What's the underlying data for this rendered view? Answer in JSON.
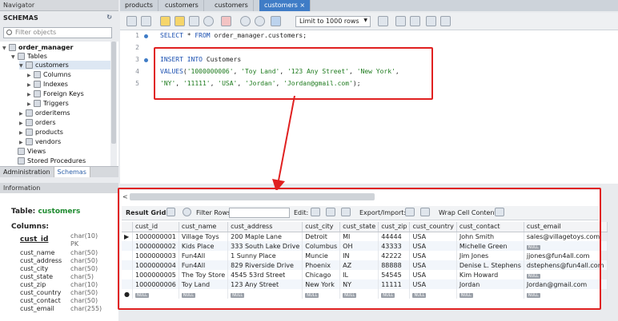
{
  "navigator": {
    "title": "Navigator",
    "schemas_label": "SCHEMAS",
    "filter_placeholder": "Filter objects",
    "tree": {
      "db": "order_manager",
      "tables": "Tables",
      "customers": "customers",
      "columns": "Columns",
      "indexes": "Indexes",
      "fkeys": "Foreign Keys",
      "triggers": "Triggers",
      "orderitems": "orderitems",
      "orders": "orders",
      "products": "products",
      "vendors": "vendors",
      "views": "Views",
      "procs": "Stored Procedures"
    },
    "tabs": [
      "Administration",
      "Schemas"
    ],
    "info_label": "Information",
    "info": {
      "table_label": "Table:",
      "table_name": "customers",
      "columns_label": "Columns:",
      "columns": [
        {
          "name": "cust_id",
          "type": "char(10)",
          "extra": "PK"
        },
        {
          "name": "cust_name",
          "type": "char(50)"
        },
        {
          "name": "cust_address",
          "type": "char(50)"
        },
        {
          "name": "cust_city",
          "type": "char(50)"
        },
        {
          "name": "cust_state",
          "type": "char(5)"
        },
        {
          "name": "cust_zip",
          "type": "char(10)"
        },
        {
          "name": "cust_country",
          "type": "char(50)"
        },
        {
          "name": "cust_contact",
          "type": "char(50)"
        },
        {
          "name": "cust_email",
          "type": "char(255)"
        }
      ]
    }
  },
  "tabs": [
    "products",
    "customers",
    "customers",
    "customers"
  ],
  "active_tab_close": "×",
  "toolbar": {
    "limit": "Limit to 1000 rows"
  },
  "editor": {
    "lines": [
      "1",
      "2",
      "3",
      "4",
      "5"
    ],
    "l1_kw1": "SELECT",
    "l1_mid": " * ",
    "l1_kw2": "FROM",
    "l1_rest": " order_manager.customers;",
    "l3_kw1": "INSERT",
    "l3_kw2": "INTO",
    "l3_rest": " Customers",
    "l4_kw": "VALUES",
    "l4_p1": "(",
    "l4_v1": "'1000000006'",
    "l4_c1": ", ",
    "l4_v2": "'Toy Land'",
    "l4_c2": ", ",
    "l4_v3": "'123 Any Street'",
    "l4_c3": ", ",
    "l4_v4": "'New York'",
    "l4_c4": ",",
    "l5_v1": "'NY'",
    "l5_c1": ", ",
    "l5_v2": "'11111'",
    "l5_c2": ", ",
    "l5_v3": "'USA'",
    "l5_c3": ", ",
    "l5_v4": "'Jordan'",
    "l5_c4": ", ",
    "l5_v5": "'Jordan@gmail.com'",
    "l5_end": ");"
  },
  "result": {
    "lt": "<",
    "grid_label": "Result Grid",
    "filter_label": "Filter Rows:",
    "edit_label": "Edit:",
    "export_label": "Export/Import:",
    "wrap_label": "Wrap Cell Content:",
    "columns": [
      "cust_id",
      "cust_name",
      "cust_address",
      "cust_city",
      "cust_state",
      "cust_zip",
      "cust_country",
      "cust_contact",
      "cust_email"
    ],
    "rows": [
      [
        "1000000001",
        "Village Toys",
        "200 Maple Lane",
        "Detroit",
        "MI",
        "44444",
        "USA",
        "John Smith",
        "sales@villagetoys.com"
      ],
      [
        "1000000002",
        "Kids Place",
        "333 South Lake Drive",
        "Columbus",
        "OH",
        "43333",
        "USA",
        "Michelle Green",
        "NULL"
      ],
      [
        "1000000003",
        "Fun4All",
        "1 Sunny Place",
        "Muncie",
        "IN",
        "42222",
        "USA",
        "Jim Jones",
        "jjones@fun4all.com"
      ],
      [
        "1000000004",
        "Fun4All",
        "829 Riverside Drive",
        "Phoenix",
        "AZ",
        "88888",
        "USA",
        "Denise L. Stephens",
        "dstephens@fun4all.com"
      ],
      [
        "1000000005",
        "The Toy Store",
        "4545 53rd Street",
        "Chicago",
        "IL",
        "54545",
        "USA",
        "Kim Howard",
        "NULL"
      ],
      [
        "1000000006",
        "Toy Land",
        "123 Any Street",
        "New York",
        "NY",
        "11111",
        "USA",
        "Jordan",
        "Jordan@gmail.com"
      ],
      [
        "NULL",
        "NULL",
        "NULL",
        "NULL",
        "NULL",
        "NULL",
        "NULL",
        "NULL",
        "NULL"
      ]
    ]
  }
}
